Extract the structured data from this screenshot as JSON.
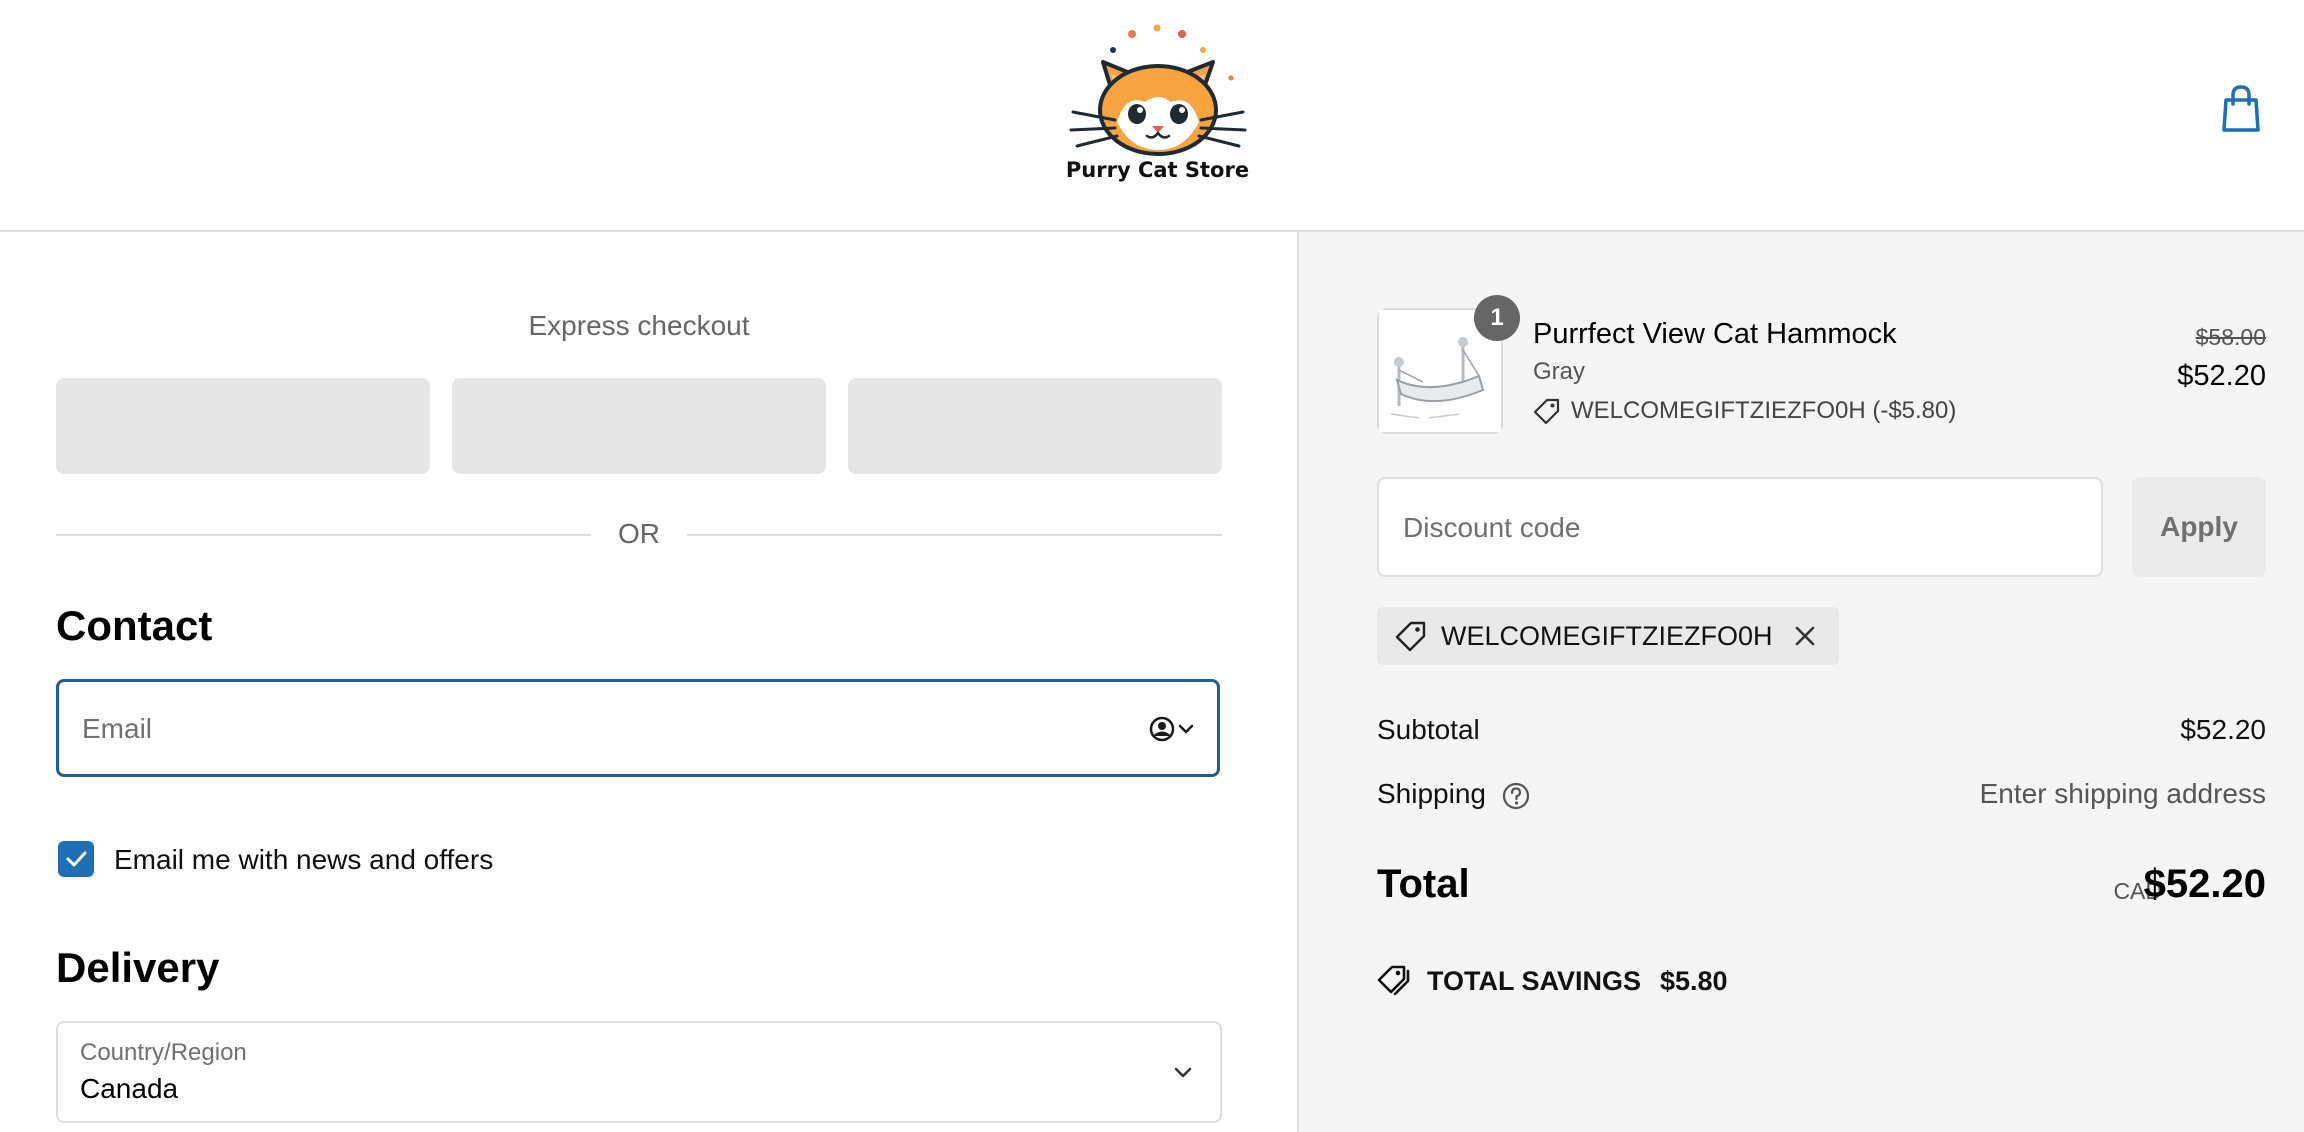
{
  "header": {
    "store_name": "Purry Cat Store",
    "cart_icon": "shopping-bag-icon"
  },
  "express_checkout": {
    "title": "Express checkout",
    "divider_text": "OR",
    "button_count": 3
  },
  "contact": {
    "title": "Contact",
    "email_placeholder": "Email",
    "email_value": "",
    "newsletter_label": "Email me with news and offers",
    "newsletter_checked": true
  },
  "delivery": {
    "title": "Delivery",
    "country_label": "Country/Region",
    "country_value": "Canada"
  },
  "order_summary": {
    "item": {
      "quantity": "1",
      "name": "Purrfect View Cat Hammock",
      "variant": "Gray",
      "discount_line": "WELCOMEGIFTZIEZFO0H (-$5.80)",
      "price_original": "$58.00",
      "price_final": "$52.20"
    },
    "discount_placeholder": "Discount code",
    "apply_label": "Apply",
    "applied_code": "WELCOMEGIFTZIEZFO0H",
    "subtotal_label": "Subtotal",
    "subtotal_value": "$52.20",
    "shipping_label": "Shipping",
    "shipping_value": "Enter shipping address",
    "total_label": "Total",
    "total_currency": "CAD",
    "total_value": "$52.20",
    "savings_label": "TOTAL SAVINGS",
    "savings_value": "$5.80"
  },
  "colors": {
    "accent": "#1f5c99",
    "checkbox": "#1f6fb5",
    "summary_bg": "#f5f5f5",
    "express_button": "#e6e6e6",
    "logo_cat": "#f6a340"
  }
}
